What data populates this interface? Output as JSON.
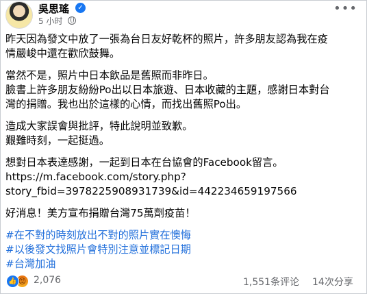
{
  "post": {
    "author": "吳思瑤",
    "time": "5 小时",
    "body": {
      "p1": [
        "昨天因為發文中放了一張為台日友好乾杯的照片，許多朋友認為我在疫",
        "情嚴峻中還在歡欣鼓舞。"
      ],
      "p2": [
        "當然不是，照片中日本飲品是舊照而非昨日。",
        "臉書上許多朋友紛紛Po出以日本旅遊、日本收藏的主題，感謝日本對台",
        "灣的捐贈。我也出於這樣的心情，而找出舊照Po出。"
      ],
      "p3": [
        "造成大家誤會與批評，特此說明並致歉。",
        "艱難時刻，一起挺過。"
      ],
      "p4": [
        "想對日本表達感謝，一起到日本在台協會的Facebook留言。"
      ],
      "link": [
        "https://m.facebook.com/story.php?",
        "story_fbid=3978225908931739&id=442234659197566"
      ],
      "p5": "好消息！美方宣布捐贈台灣75萬劑疫苗！",
      "hashtags": [
        "#在不對的時刻放出不對的照片實在懊悔",
        "#以後發文找照片會特別注意並標記日期",
        "#台灣加油"
      ]
    }
  },
  "footer": {
    "reactions": "2,076",
    "comments": "1,551条评论",
    "shares": "14次分享"
  },
  "icons": {
    "verified": "verified-badge-icon",
    "privacy": "globe-icon",
    "more": "more-options-icon",
    "like": "like-reaction-icon",
    "angry": "angry-reaction-icon"
  },
  "colors": {
    "hashtag": "#216fdb",
    "verified": "#1877f2",
    "meta_text": "#65676b"
  }
}
